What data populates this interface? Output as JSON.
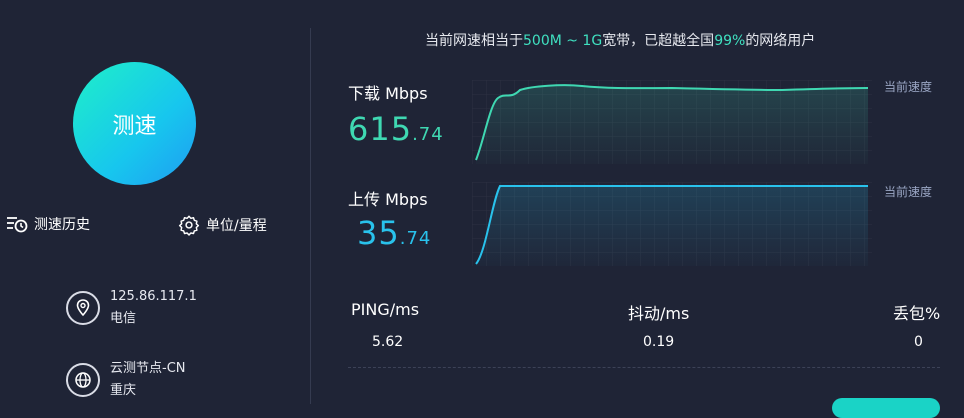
{
  "speed_test": {
    "button_label": "测速"
  },
  "links": {
    "history": "测速历史",
    "units": "单位/量程"
  },
  "info": {
    "ip": "125.86.117.1",
    "isp": "电信",
    "node": "云测节点-CN",
    "city": "重庆"
  },
  "headline": {
    "prefix": "当前网速相当于",
    "range": "500M ~ 1G",
    "mid": "宽带，已超越全国",
    "percent": "99%",
    "suffix": "的网络用户"
  },
  "download": {
    "label": "下载 Mbps",
    "int": "615",
    "dec": ".74",
    "current_label": "当前速度",
    "color": "#3fd8b2"
  },
  "upload": {
    "label": "上传 Mbps",
    "int": "35",
    "dec": ".74",
    "current_label": "当前速度",
    "color": "#29c2ec"
  },
  "stats": {
    "ping_label": "PING/ms",
    "ping_value": "5.62",
    "jitter_label": "抖动/ms",
    "jitter_value": "0.19",
    "loss_label": "丢包%",
    "loss_value": "0"
  }
}
